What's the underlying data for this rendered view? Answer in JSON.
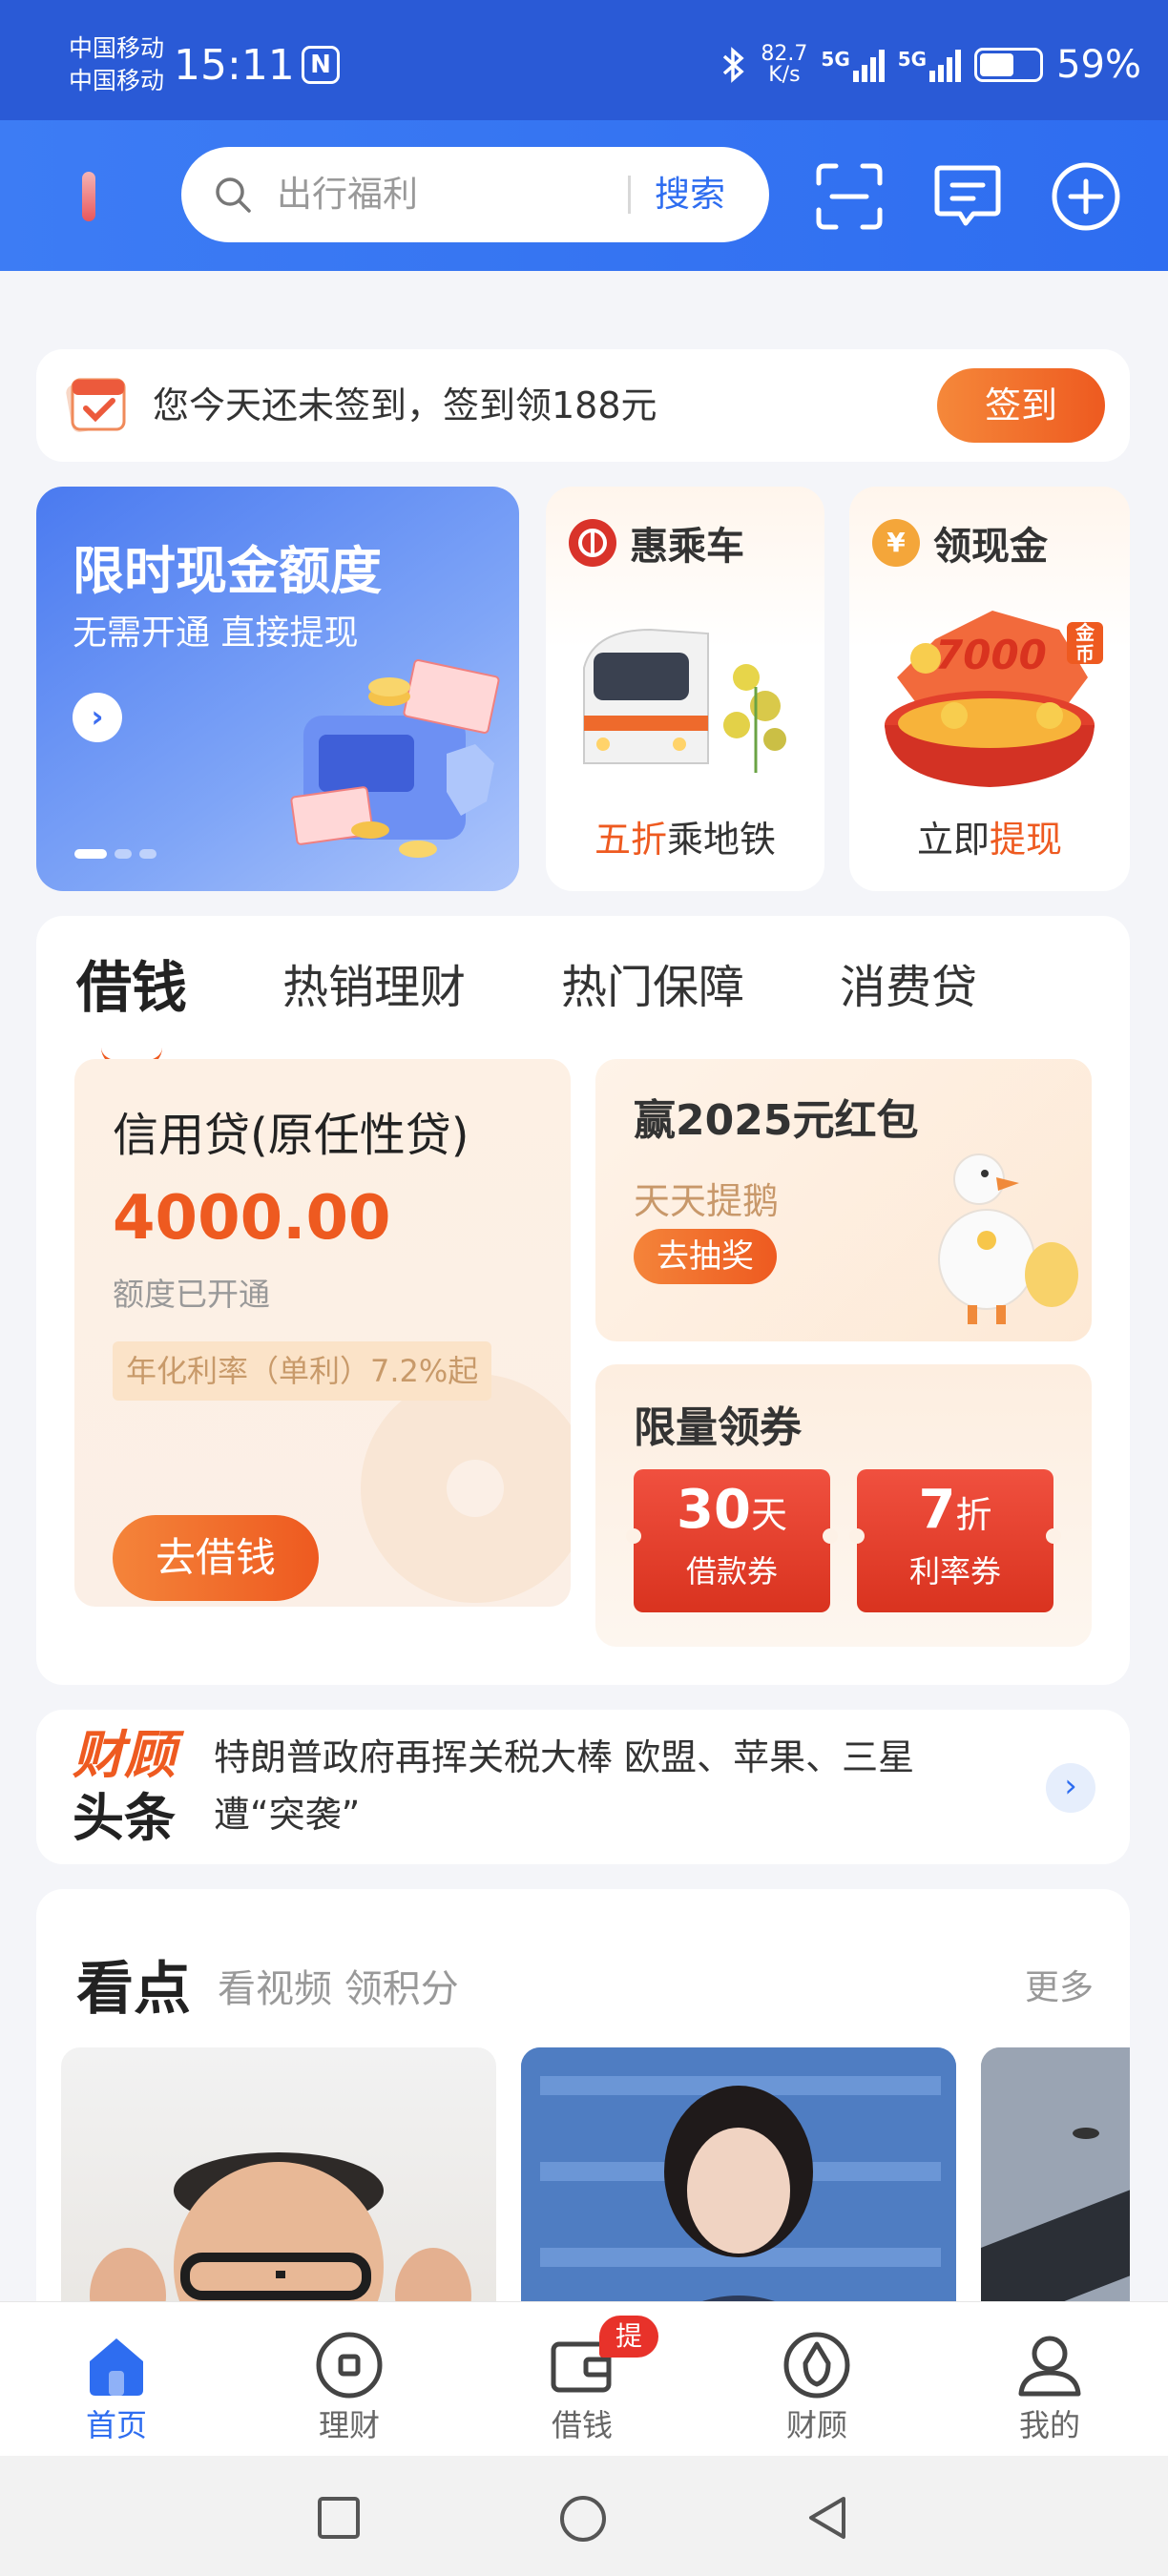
{
  "status_bar": {
    "carrier1": "中国移动",
    "carrier2": "中国移动",
    "time": "15:11",
    "net_speed_value": "82.7",
    "net_speed_unit": "K/s",
    "sig_label1": "5G",
    "sig_label2": "5G",
    "battery": "59%",
    "battery_level": 0.59
  },
  "header": {
    "search_placeholder": "出行福利",
    "search_button": "搜索"
  },
  "checkin": {
    "text": "您今天还未签到，签到领188元",
    "button": "签到"
  },
  "banner": {
    "title": "限时现金额度",
    "subtitle": "无需开通 直接提现",
    "arrow": "›"
  },
  "promos": [
    {
      "title": "惠乘车",
      "caption_highlight": "五折",
      "caption_rest": "乘地铁"
    },
    {
      "title": "领现金",
      "caption_rest": "立即",
      "caption_highlight": "提现",
      "coin_text": "7000",
      "coin_unit": "金币"
    }
  ],
  "loan_tabs": [
    "借钱",
    "热销理财",
    "热门保障",
    "消费贷"
  ],
  "credit": {
    "title": "信用贷(原任性贷)",
    "amount": "4000.00",
    "status": "额度已开通",
    "rate": "年化利率（单利）7.2%起",
    "button": "去借钱"
  },
  "redpacket": {
    "title": "赢2025元红包",
    "subtitle": "天天提鹅",
    "button": "去抽奖"
  },
  "coupons": {
    "title": "限量领券",
    "items": [
      {
        "value": "30",
        "unit": "天",
        "name": "借款券"
      },
      {
        "value": "7",
        "unit": "折",
        "name": "利率券"
      }
    ]
  },
  "news": {
    "logo_line1": "财顾",
    "logo_line2": "头条",
    "text": "特朗普政府再挥关税大棒 欧盟、苹果、三星遭“突袭”",
    "arrow": "›"
  },
  "kandian": {
    "title": "看点",
    "subtitle": "看视频 领积分",
    "more": "更多"
  },
  "bottom_nav": [
    {
      "label": "首页",
      "icon": "home-icon"
    },
    {
      "label": "理财",
      "icon": "wealth-icon"
    },
    {
      "label": "借钱",
      "icon": "wallet-icon",
      "badge": "提现"
    },
    {
      "label": "财顾",
      "icon": "advisor-icon"
    },
    {
      "label": "我的",
      "icon": "profile-icon"
    }
  ],
  "colors": {
    "brand_blue": "#2e6df0",
    "accent_orange": "#ee5a20"
  }
}
